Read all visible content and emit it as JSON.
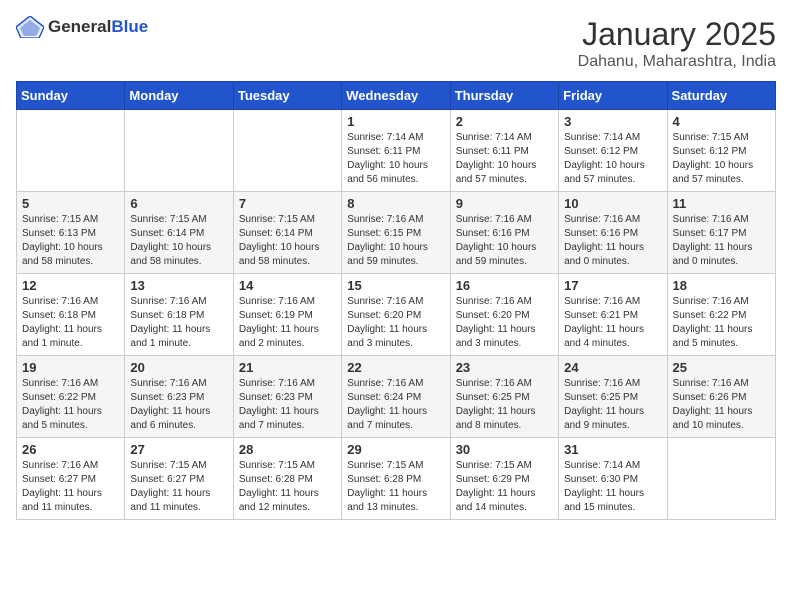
{
  "header": {
    "logo_general": "General",
    "logo_blue": "Blue",
    "month": "January 2025",
    "location": "Dahanu, Maharashtra, India"
  },
  "weekdays": [
    "Sunday",
    "Monday",
    "Tuesday",
    "Wednesday",
    "Thursday",
    "Friday",
    "Saturday"
  ],
  "weeks": [
    [
      {
        "day": "",
        "info": ""
      },
      {
        "day": "",
        "info": ""
      },
      {
        "day": "",
        "info": ""
      },
      {
        "day": "1",
        "info": "Sunrise: 7:14 AM\nSunset: 6:11 PM\nDaylight: 10 hours and 56 minutes."
      },
      {
        "day": "2",
        "info": "Sunrise: 7:14 AM\nSunset: 6:11 PM\nDaylight: 10 hours and 57 minutes."
      },
      {
        "day": "3",
        "info": "Sunrise: 7:14 AM\nSunset: 6:12 PM\nDaylight: 10 hours and 57 minutes."
      },
      {
        "day": "4",
        "info": "Sunrise: 7:15 AM\nSunset: 6:12 PM\nDaylight: 10 hours and 57 minutes."
      }
    ],
    [
      {
        "day": "5",
        "info": "Sunrise: 7:15 AM\nSunset: 6:13 PM\nDaylight: 10 hours and 58 minutes."
      },
      {
        "day": "6",
        "info": "Sunrise: 7:15 AM\nSunset: 6:14 PM\nDaylight: 10 hours and 58 minutes."
      },
      {
        "day": "7",
        "info": "Sunrise: 7:15 AM\nSunset: 6:14 PM\nDaylight: 10 hours and 58 minutes."
      },
      {
        "day": "8",
        "info": "Sunrise: 7:16 AM\nSunset: 6:15 PM\nDaylight: 10 hours and 59 minutes."
      },
      {
        "day": "9",
        "info": "Sunrise: 7:16 AM\nSunset: 6:16 PM\nDaylight: 10 hours and 59 minutes."
      },
      {
        "day": "10",
        "info": "Sunrise: 7:16 AM\nSunset: 6:16 PM\nDaylight: 11 hours and 0 minutes."
      },
      {
        "day": "11",
        "info": "Sunrise: 7:16 AM\nSunset: 6:17 PM\nDaylight: 11 hours and 0 minutes."
      }
    ],
    [
      {
        "day": "12",
        "info": "Sunrise: 7:16 AM\nSunset: 6:18 PM\nDaylight: 11 hours and 1 minute."
      },
      {
        "day": "13",
        "info": "Sunrise: 7:16 AM\nSunset: 6:18 PM\nDaylight: 11 hours and 1 minute."
      },
      {
        "day": "14",
        "info": "Sunrise: 7:16 AM\nSunset: 6:19 PM\nDaylight: 11 hours and 2 minutes."
      },
      {
        "day": "15",
        "info": "Sunrise: 7:16 AM\nSunset: 6:20 PM\nDaylight: 11 hours and 3 minutes."
      },
      {
        "day": "16",
        "info": "Sunrise: 7:16 AM\nSunset: 6:20 PM\nDaylight: 11 hours and 3 minutes."
      },
      {
        "day": "17",
        "info": "Sunrise: 7:16 AM\nSunset: 6:21 PM\nDaylight: 11 hours and 4 minutes."
      },
      {
        "day": "18",
        "info": "Sunrise: 7:16 AM\nSunset: 6:22 PM\nDaylight: 11 hours and 5 minutes."
      }
    ],
    [
      {
        "day": "19",
        "info": "Sunrise: 7:16 AM\nSunset: 6:22 PM\nDaylight: 11 hours and 5 minutes."
      },
      {
        "day": "20",
        "info": "Sunrise: 7:16 AM\nSunset: 6:23 PM\nDaylight: 11 hours and 6 minutes."
      },
      {
        "day": "21",
        "info": "Sunrise: 7:16 AM\nSunset: 6:23 PM\nDaylight: 11 hours and 7 minutes."
      },
      {
        "day": "22",
        "info": "Sunrise: 7:16 AM\nSunset: 6:24 PM\nDaylight: 11 hours and 7 minutes."
      },
      {
        "day": "23",
        "info": "Sunrise: 7:16 AM\nSunset: 6:25 PM\nDaylight: 11 hours and 8 minutes."
      },
      {
        "day": "24",
        "info": "Sunrise: 7:16 AM\nSunset: 6:25 PM\nDaylight: 11 hours and 9 minutes."
      },
      {
        "day": "25",
        "info": "Sunrise: 7:16 AM\nSunset: 6:26 PM\nDaylight: 11 hours and 10 minutes."
      }
    ],
    [
      {
        "day": "26",
        "info": "Sunrise: 7:16 AM\nSunset: 6:27 PM\nDaylight: 11 hours and 11 minutes."
      },
      {
        "day": "27",
        "info": "Sunrise: 7:15 AM\nSunset: 6:27 PM\nDaylight: 11 hours and 11 minutes."
      },
      {
        "day": "28",
        "info": "Sunrise: 7:15 AM\nSunset: 6:28 PM\nDaylight: 11 hours and 12 minutes."
      },
      {
        "day": "29",
        "info": "Sunrise: 7:15 AM\nSunset: 6:28 PM\nDaylight: 11 hours and 13 minutes."
      },
      {
        "day": "30",
        "info": "Sunrise: 7:15 AM\nSunset: 6:29 PM\nDaylight: 11 hours and 14 minutes."
      },
      {
        "day": "31",
        "info": "Sunrise: 7:14 AM\nSunset: 6:30 PM\nDaylight: 11 hours and 15 minutes."
      },
      {
        "day": "",
        "info": ""
      }
    ]
  ]
}
